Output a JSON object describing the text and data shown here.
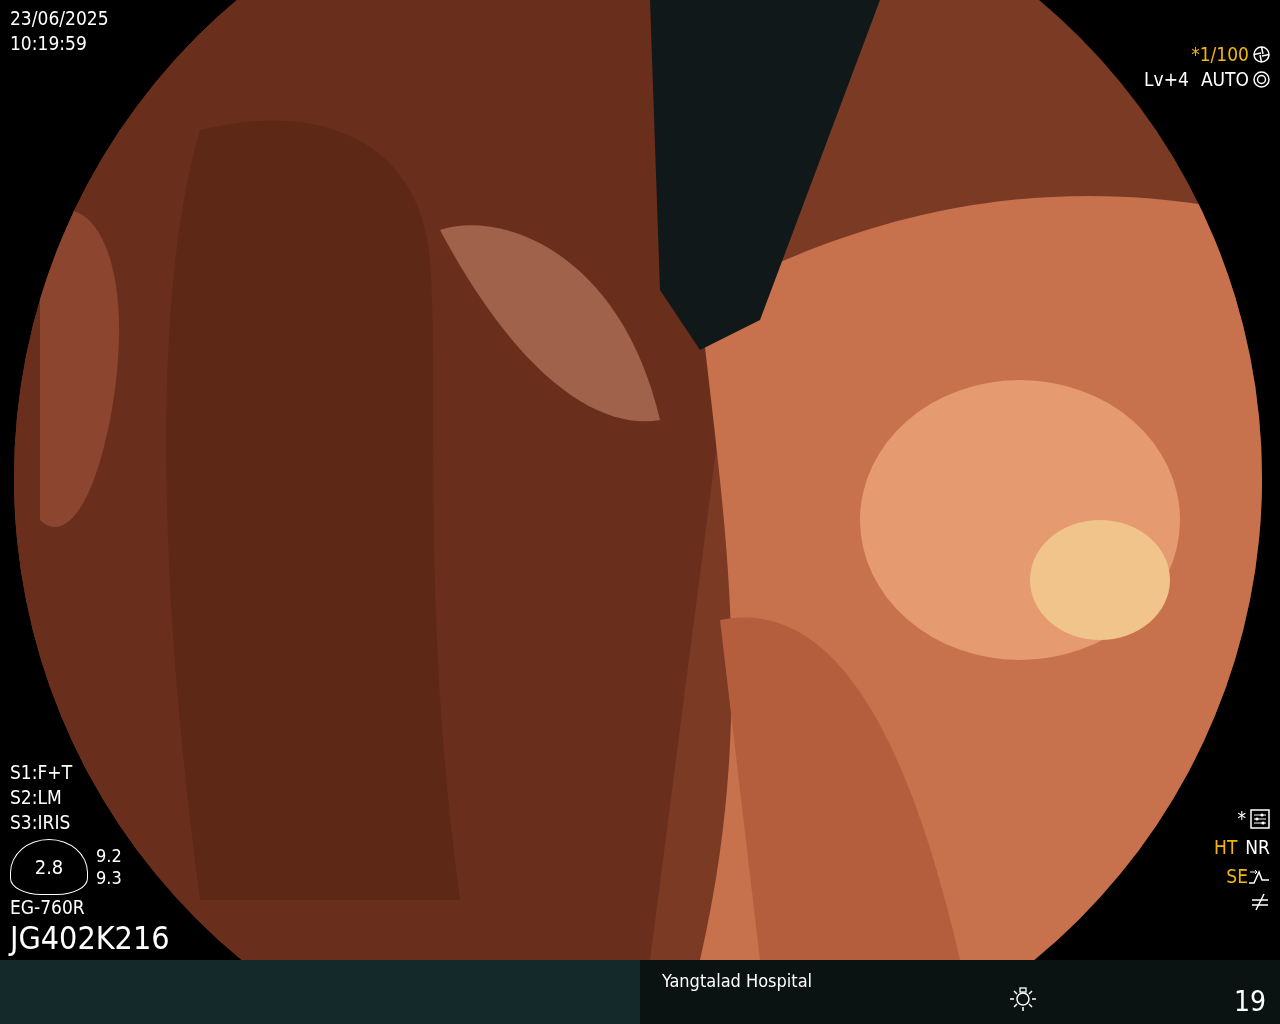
{
  "datetime": {
    "date": "23/06/2025",
    "time": "10:19:59"
  },
  "shutter": {
    "text": "*1/100",
    "active": true
  },
  "exposure": {
    "level": "Lv+4",
    "mode": "AUTO",
    "active": false
  },
  "switches": [
    {
      "label": "S1:",
      "value": "F+T"
    },
    {
      "label": "S2:",
      "value": "LM"
    },
    {
      "label": "S3:",
      "value": "IRIS"
    }
  ],
  "scope_gauge": {
    "value": "2.8",
    "readings": [
      "9.2",
      "9.3"
    ]
  },
  "scope_model": "EG-760R",
  "serial": "JG402K216",
  "settings_mark": "*",
  "indicators": [
    {
      "label": "HT",
      "active": true
    },
    {
      "label": "NR",
      "active": false
    }
  ],
  "structure": {
    "label": "SE",
    "active": true
  },
  "footer": {
    "hospital": "Yangtalad Hospital",
    "frame": "19"
  }
}
